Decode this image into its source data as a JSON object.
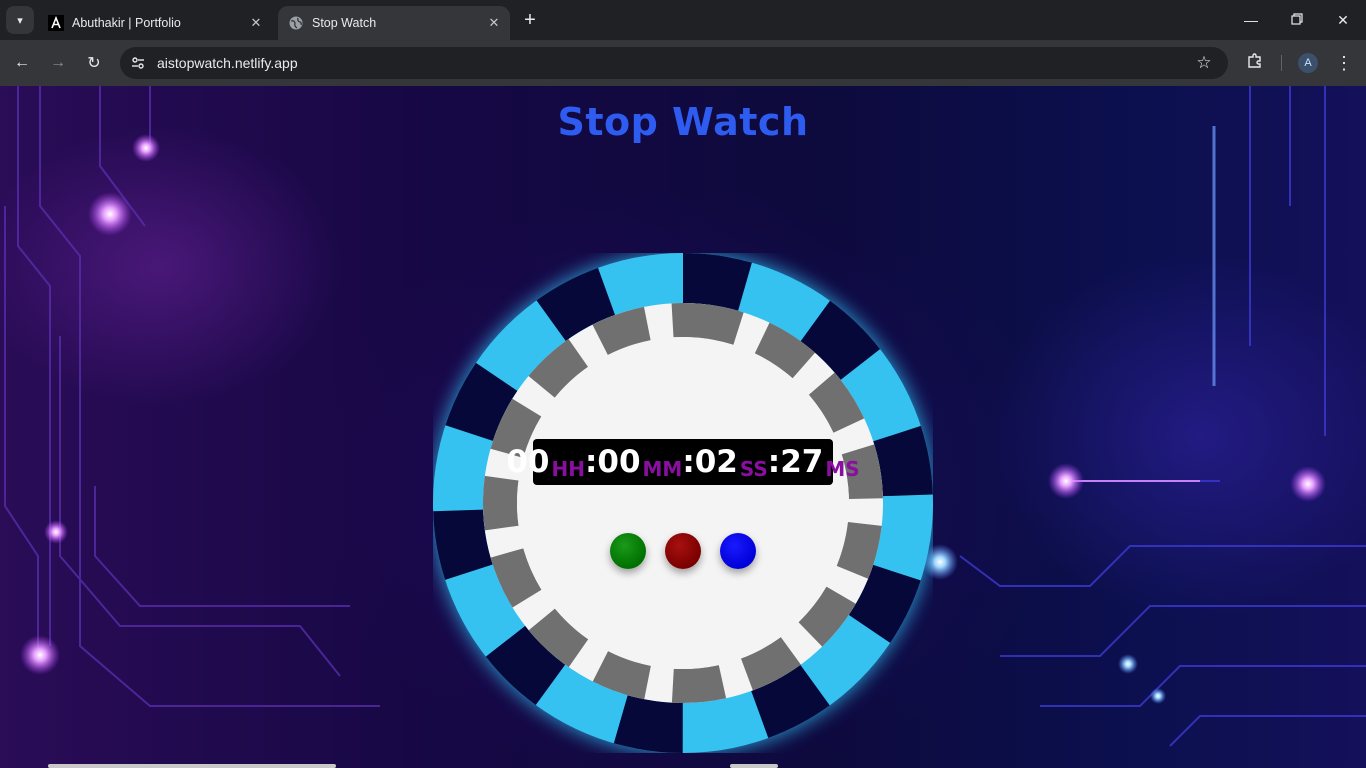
{
  "browser": {
    "tabs": [
      {
        "title": "Abuthakir | Portfolio",
        "favicon": "letter-a-icon",
        "active": false
      },
      {
        "title": "Stop Watch",
        "favicon": "globe-icon",
        "active": true
      }
    ],
    "url": "aistopwatch.netlify.app",
    "profile_initial": "A"
  },
  "page": {
    "title": "Stop Watch",
    "timer": {
      "hours": "00",
      "hours_unit": "HH",
      "minutes": "00",
      "minutes_unit": "MM",
      "seconds": "02",
      "seconds_unit": "SS",
      "milliseconds": "27",
      "milliseconds_unit": "MS",
      "separator": ":"
    },
    "buttons": [
      {
        "name": "start",
        "color": "#008000"
      },
      {
        "name": "stop",
        "color": "#8b0000"
      },
      {
        "name": "reset",
        "color": "#0000ff"
      }
    ],
    "colors": {
      "title": "#2e5cf0",
      "ring_light": "#35c2f0",
      "ring_dark": "#07083a",
      "inner_ticks": "#707070",
      "face": "#f4f4f4",
      "unit_label": "#8a0fa0"
    }
  }
}
